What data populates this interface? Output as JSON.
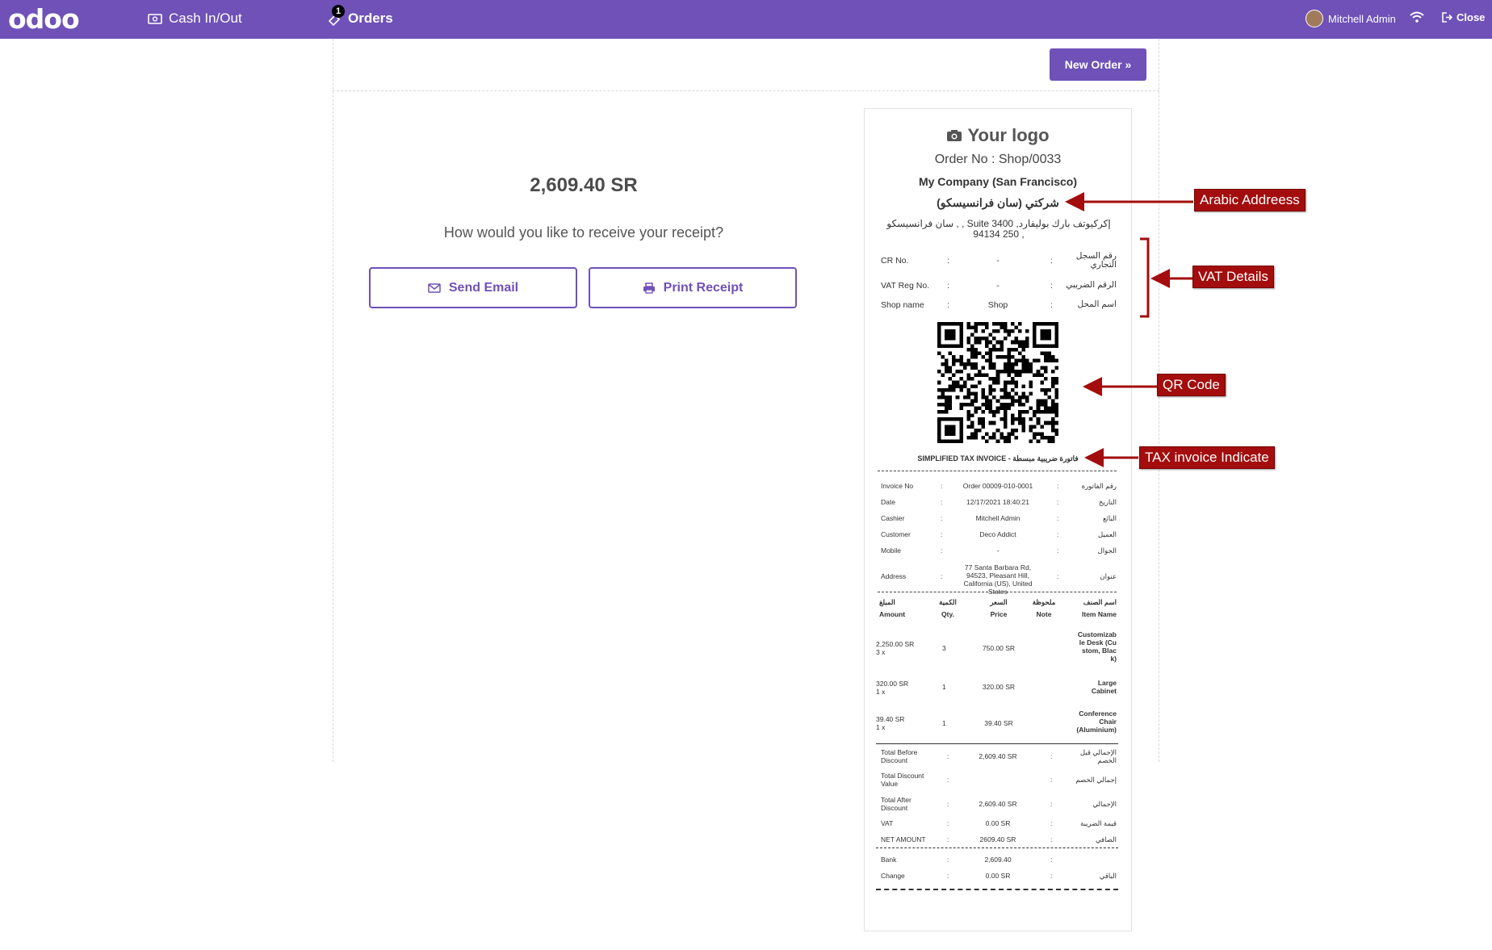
{
  "topbar": {
    "brand": "odoo",
    "cash_label": "Cash In/Out",
    "orders_label": "Orders",
    "orders_badge": "1",
    "user_name": "Mitchell Admin",
    "close_label": "Close"
  },
  "screen": {
    "new_order_label": "New Order »",
    "amount": "2,609.40 SR",
    "question": "How would you like to receive your receipt?",
    "send_email_label": "Send Email",
    "print_receipt_label": "Print Receipt"
  },
  "receipt": {
    "logo_text": "Your logo",
    "order_no": "Order No : Shop/0033",
    "company": "My Company (San Francisco)",
    "company_ar": "شركتي (سان فرانسيسكو)",
    "address": "سان فرانسيسكو , , Suite 3400 ,إكركيوتف بارك بوليفارد 250 94134 ,",
    "vat": [
      {
        "label": "CR No.",
        "value": "-",
        "ar": "رقم السجل التجاري"
      },
      {
        "label": "VAT Reg No.",
        "value": "-",
        "ar": "الرقم الضريبي"
      },
      {
        "label": "Shop name",
        "value": "Shop",
        "ar": "اسم المحل"
      }
    ],
    "sep": ":",
    "invoice_title": "SIMPLIFIED TAX INVOICE - فاتورة ضريبية مبسطة",
    "info": [
      {
        "label": "Invoice No",
        "value": "Order 00009-010-0001",
        "ar": "رقم الفاتورة"
      },
      {
        "label": "Date",
        "value": "12/17/2021 18:40:21",
        "ar": "التاريخ"
      },
      {
        "label": "Cashier",
        "value": "Mitchell Admin",
        "ar": "البائع"
      },
      {
        "label": "Customer",
        "value": "Deco Addict",
        "ar": "العميل"
      },
      {
        "label": "Mobile",
        "value": "-",
        "ar": "الجوال"
      },
      {
        "label": "Address",
        "value": "77 Santa Barbara Rd, 94523, Pleasant Hill, California (US), United States",
        "ar": "عنوان"
      }
    ],
    "columns": {
      "amount_ar": "المبلغ",
      "amount": "Amount",
      "qty_ar": "الكمية",
      "qty": "Qty.",
      "price_ar": "السعر",
      "price": "Price",
      "note_ar": "ملحوظة",
      "note": "Note",
      "item_ar": "اسم الصنف",
      "item": "Item Name"
    },
    "lines": [
      {
        "amount": "2,250.00 SR",
        "qtyx": "3 x",
        "qty": "3",
        "price": "750.00 SR",
        "item": "Customizable Desk (Custom, Black)"
      },
      {
        "amount": "320.00 SR",
        "qtyx": "1 x",
        "qty": "1",
        "price": "320.00 SR",
        "item": "Large Cabinet"
      },
      {
        "amount": "39.40 SR",
        "qtyx": "1 x",
        "qty": "1",
        "price": "39.40 SR",
        "item": "Conference Chair (Aluminium)"
      }
    ],
    "totals": [
      {
        "label": "Total Before Discount",
        "value": "2,609.40 SR",
        "ar": "الإجمالي قبل الخصم"
      },
      {
        "label": "Total Discount Value",
        "value": "",
        "ar": "إجمالي الخصم"
      },
      {
        "label": "Total After Discount",
        "value": "2,609.40 SR",
        "ar": "الإجمالي"
      },
      {
        "label": "VAT",
        "value": "0.00 SR",
        "ar": "قيمة الضريبة"
      },
      {
        "label": "NET AMOUNT",
        "value": "2609.40 SR",
        "ar": "الصافي"
      }
    ],
    "payments": [
      {
        "label": "Bank",
        "value": "2,609.40",
        "ar": ""
      },
      {
        "label": "Change",
        "value": "0.00 SR",
        "ar": "الباقي"
      }
    ]
  },
  "annotations": {
    "arabic_address": "Arabic Addreess",
    "vat_details": "VAT Details",
    "qr_code": "QR Code",
    "tax_invoice": "TAX invoice Indicate"
  },
  "colors": {
    "brand": "#6f51b8",
    "annotation": "#a30d0d"
  }
}
